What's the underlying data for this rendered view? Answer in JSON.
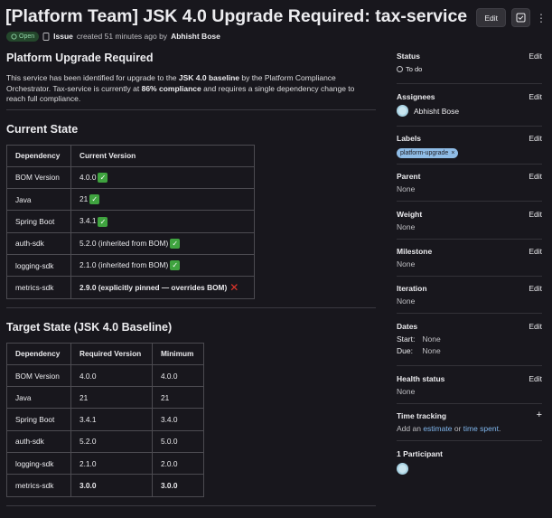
{
  "header": {
    "title": "[Platform Team] JSK 4.0 Upgrade Required: tax-service",
    "edit_label": "Edit",
    "kebab": "⋮"
  },
  "meta": {
    "status": "Open",
    "type": "Issue",
    "created_text": "created 51 minutes ago by",
    "author": "Abhisht Bose"
  },
  "main": {
    "heading": "Platform Upgrade Required",
    "intro_1": "This service has been identified for upgrade to the ",
    "intro_b1": "JSK 4.0 baseline",
    "intro_2": " by the Platform Compliance Orchestrator. Tax-service is currently at ",
    "intro_b2": "86% compliance",
    "intro_3": " and requires a single dependency change to reach full compliance.",
    "current_heading": "Current State",
    "current_table": {
      "headers": [
        "Dependency",
        "Current Version"
      ],
      "rows": [
        {
          "dep": "BOM Version",
          "ver": "4.0.0",
          "mark": "check"
        },
        {
          "dep": "Java",
          "ver": "21",
          "mark": "check"
        },
        {
          "dep": "Spring Boot",
          "ver": "3.4.1",
          "mark": "check"
        },
        {
          "dep": "auth-sdk",
          "ver": "5.2.0 (inherited from BOM)",
          "mark": "check"
        },
        {
          "dep": "logging-sdk",
          "ver": "2.1.0 (inherited from BOM)",
          "mark": "check"
        },
        {
          "dep": "metrics-sdk",
          "ver": "2.9.0 (explicitly pinned — overrides BOM)",
          "mark": "cross"
        }
      ]
    },
    "target_heading": "Target State (JSK 4.0 Baseline)",
    "target_table": {
      "headers": [
        "Dependency",
        "Required Version",
        "Minimum"
      ],
      "rows": [
        {
          "dep": "BOM Version",
          "req": "4.0.0",
          "min": "4.0.0"
        },
        {
          "dep": "Java",
          "req": "21",
          "min": "21"
        },
        {
          "dep": "Spring Boot",
          "req": "3.4.1",
          "min": "3.4.0"
        },
        {
          "dep": "auth-sdk",
          "req": "5.2.0",
          "min": "5.0.0"
        },
        {
          "dep": "logging-sdk",
          "req": "2.1.0",
          "min": "2.0.0"
        },
        {
          "dep": "metrics-sdk",
          "req": "3.0.0",
          "min": "3.0.0"
        }
      ]
    }
  },
  "sidebar": {
    "edit": "Edit",
    "status": {
      "label": "Status",
      "value": "To do"
    },
    "assignees": {
      "label": "Assignees",
      "value": "Abhisht Bose"
    },
    "labels": {
      "label": "Labels",
      "value": "platform-upgrade",
      "remove": "×"
    },
    "parent": {
      "label": "Parent",
      "value": "None"
    },
    "weight": {
      "label": "Weight",
      "value": "None"
    },
    "milestone": {
      "label": "Milestone",
      "value": "None"
    },
    "iteration": {
      "label": "Iteration",
      "value": "None"
    },
    "dates": {
      "label": "Dates",
      "start_key": "Start:",
      "start": "None",
      "due_key": "Due:",
      "due": "None"
    },
    "health": {
      "label": "Health status",
      "value": "None"
    },
    "time": {
      "label": "Time tracking",
      "plus": "+",
      "add": "Add an",
      "estimate": "estimate",
      "or": "or",
      "spent": "time spent",
      "dot": "."
    },
    "participants": {
      "label": "1 Participant"
    }
  }
}
